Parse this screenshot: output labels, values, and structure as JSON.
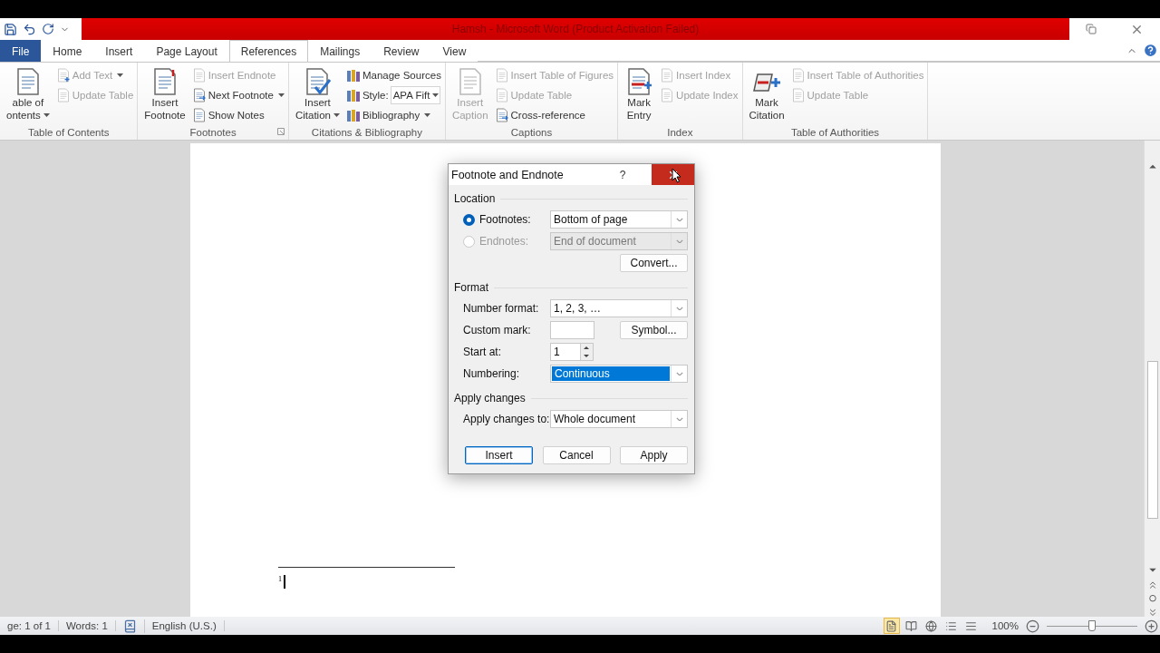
{
  "title_bar": {
    "title": "Hamsh  -  Microsoft Word (Product Activation Failed)"
  },
  "tabs": [
    {
      "label": "File",
      "kind": "file",
      "selected": false
    },
    {
      "label": "Home",
      "kind": "tab",
      "selected": false
    },
    {
      "label": "Insert",
      "kind": "tab",
      "selected": false
    },
    {
      "label": "Page Layout",
      "kind": "tab",
      "selected": false
    },
    {
      "label": "References",
      "kind": "tab",
      "selected": true
    },
    {
      "label": "Mailings",
      "kind": "tab",
      "selected": false
    },
    {
      "label": "Review",
      "kind": "tab",
      "selected": false
    },
    {
      "label": "View",
      "kind": "tab",
      "selected": false
    }
  ],
  "ribbon": {
    "groups": [
      {
        "label": "Table of Contents",
        "launcher": false,
        "items": [
          {
            "kind": "large",
            "lines": [
              "able of",
              "ontents"
            ],
            "dropdown": true,
            "disabled": false
          },
          {
            "kind": "small",
            "label": "Add Text",
            "dropdown": true,
            "disabled": true
          },
          {
            "kind": "small",
            "label": "Update Table",
            "dropdown": false,
            "disabled": true
          }
        ]
      },
      {
        "label": "Footnotes",
        "launcher": true,
        "items": [
          {
            "kind": "large",
            "lines": [
              "Insert",
              "Footnote"
            ],
            "dropdown": false,
            "disabled": false
          },
          {
            "kind": "small",
            "label": "Insert Endnote",
            "dropdown": false,
            "disabled": true
          },
          {
            "kind": "small",
            "label": "Next Footnote",
            "dropdown": true,
            "disabled": false
          },
          {
            "kind": "small",
            "label": "Show Notes",
            "dropdown": false,
            "disabled": false
          }
        ]
      },
      {
        "label": "Citations & Bibliography",
        "launcher": false,
        "items": [
          {
            "kind": "large",
            "lines": [
              "Insert",
              "Citation"
            ],
            "dropdown": true,
            "disabled": false
          },
          {
            "kind": "small",
            "label": "Manage Sources",
            "dropdown": false,
            "disabled": false
          },
          {
            "kind": "combo",
            "label": "Style:",
            "value": "APA Fift"
          },
          {
            "kind": "small",
            "label": "Bibliography",
            "dropdown": true,
            "disabled": false
          }
        ]
      },
      {
        "label": "Captions",
        "launcher": false,
        "items": [
          {
            "kind": "large",
            "lines": [
              "Insert",
              "Caption"
            ],
            "dropdown": false,
            "disabled": true
          },
          {
            "kind": "small",
            "label": "Insert Table of Figures",
            "dropdown": false,
            "disabled": true
          },
          {
            "kind": "small",
            "label": "Update Table",
            "dropdown": false,
            "disabled": true
          },
          {
            "kind": "small",
            "label": "Cross-reference",
            "dropdown": false,
            "disabled": false
          }
        ]
      },
      {
        "label": "Index",
        "launcher": false,
        "items": [
          {
            "kind": "large",
            "lines": [
              "Mark",
              "Entry"
            ],
            "dropdown": false,
            "disabled": false
          },
          {
            "kind": "small",
            "label": "Insert Index",
            "dropdown": false,
            "disabled": true
          },
          {
            "kind": "small",
            "label": "Update Index",
            "dropdown": false,
            "disabled": true
          }
        ]
      },
      {
        "label": "Table of Authorities",
        "launcher": false,
        "items": [
          {
            "kind": "large",
            "lines": [
              "Mark",
              "Citation"
            ],
            "dropdown": false,
            "disabled": false
          },
          {
            "kind": "small",
            "label": "Insert Table of Authorities",
            "dropdown": false,
            "disabled": true
          },
          {
            "kind": "small",
            "label": "Update Table",
            "dropdown": false,
            "disabled": true
          }
        ]
      }
    ]
  },
  "document": {
    "footnote_mark": "1"
  },
  "dialog": {
    "title": "Footnote and Endnote",
    "help": "?",
    "close_hovered": true,
    "sections": [
      {
        "heading": "Location",
        "rows": [
          {
            "kind": "radio",
            "label": "Footnotes:",
            "selected": true,
            "disabled": false,
            "value": "Bottom of page"
          },
          {
            "kind": "radio",
            "label": "Endnotes:",
            "selected": false,
            "disabled": true,
            "value": "End of document"
          },
          {
            "kind": "button",
            "label": "Convert..."
          }
        ]
      },
      {
        "heading": "Format",
        "rows": [
          {
            "kind": "select",
            "label": "Number format:",
            "value": "1, 2, 3, …",
            "highlighted": false
          },
          {
            "kind": "input",
            "label": "Custom mark:",
            "button": "Symbol..."
          },
          {
            "kind": "spinner",
            "label": "Start at:",
            "value": "1"
          },
          {
            "kind": "select",
            "label": "Numbering:",
            "value": "Continuous",
            "highlighted": true
          }
        ]
      },
      {
        "heading": "Apply changes",
        "rows": [
          {
            "kind": "select",
            "label": "Apply changes to:",
            "value": "Whole document",
            "highlighted": false
          }
        ]
      }
    ],
    "buttons": [
      {
        "label": "Insert",
        "default": true
      },
      {
        "label": "Cancel",
        "default": false
      },
      {
        "label": "Apply",
        "default": false
      }
    ]
  },
  "status_bar": {
    "page": "ge: 1 of 1",
    "words": "Words: 1",
    "language": "English (U.S.)",
    "views": [
      {
        "selected": true
      },
      {
        "selected": false
      },
      {
        "selected": false
      },
      {
        "selected": false
      },
      {
        "selected": false
      }
    ],
    "zoom": "100%",
    "zoom_slider": {
      "level": 0.5
    }
  }
}
